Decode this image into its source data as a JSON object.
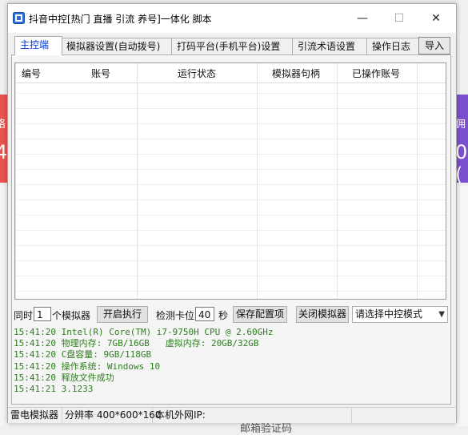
{
  "window": {
    "title": "抖音中控[热门 直播 引流 养号]一体化 脚本",
    "minimize_glyph": "—",
    "maximize_glyph": "☐",
    "close_glyph": "✕"
  },
  "background": {
    "left_char": "4",
    "right_char": "0.(",
    "right_top": "佣",
    "left_top": "络",
    "bottom_text": "邮箱验证码"
  },
  "tabs": [
    {
      "label": "主控端",
      "active": true
    },
    {
      "label": "模拟器设置(自动拨号)",
      "active": false
    },
    {
      "label": "打码平台(手机平台)设置",
      "active": false
    },
    {
      "label": "引流术语设置",
      "active": false
    },
    {
      "label": "操作日志",
      "active": false
    }
  ],
  "import_label": "导入",
  "table": {
    "columns": [
      "编号",
      "账号",
      "运行状态",
      "模拟器句柄",
      "已操作账号"
    ],
    "rows": []
  },
  "controls": {
    "simultaneous_label": "同时",
    "simultaneous_value": "1",
    "emulator_unit": "个模拟器",
    "start_button": "开启执行",
    "check_stuck_label": "检测卡位",
    "check_stuck_value": "40",
    "seconds_unit": "秒",
    "save_button": "保存配置项",
    "close_emulator_button": "关闭模拟器",
    "mode_select": "请选择中控模式"
  },
  "log": [
    "15:41:20 Intel(R) Core(TM) i7-9750H CPU @ 2.60GHz",
    "15:41:20 物理内存: 7GB/16GB   虚拟内存: 20GB/32GB",
    "15:41:20 C盘容量: 9GB/118GB",
    "15:41:20 操作系统: Windows 10",
    "15:41:20 释放文件成功",
    "15:41:21 3.1233"
  ],
  "status": {
    "emulator": "雷电模拟器",
    "resolution": "分辨率 400*600*160",
    "ip": "本机外网IP:"
  },
  "colors": {
    "log_text": "#2e7d1f",
    "active_tab_text": "#0033cc"
  }
}
